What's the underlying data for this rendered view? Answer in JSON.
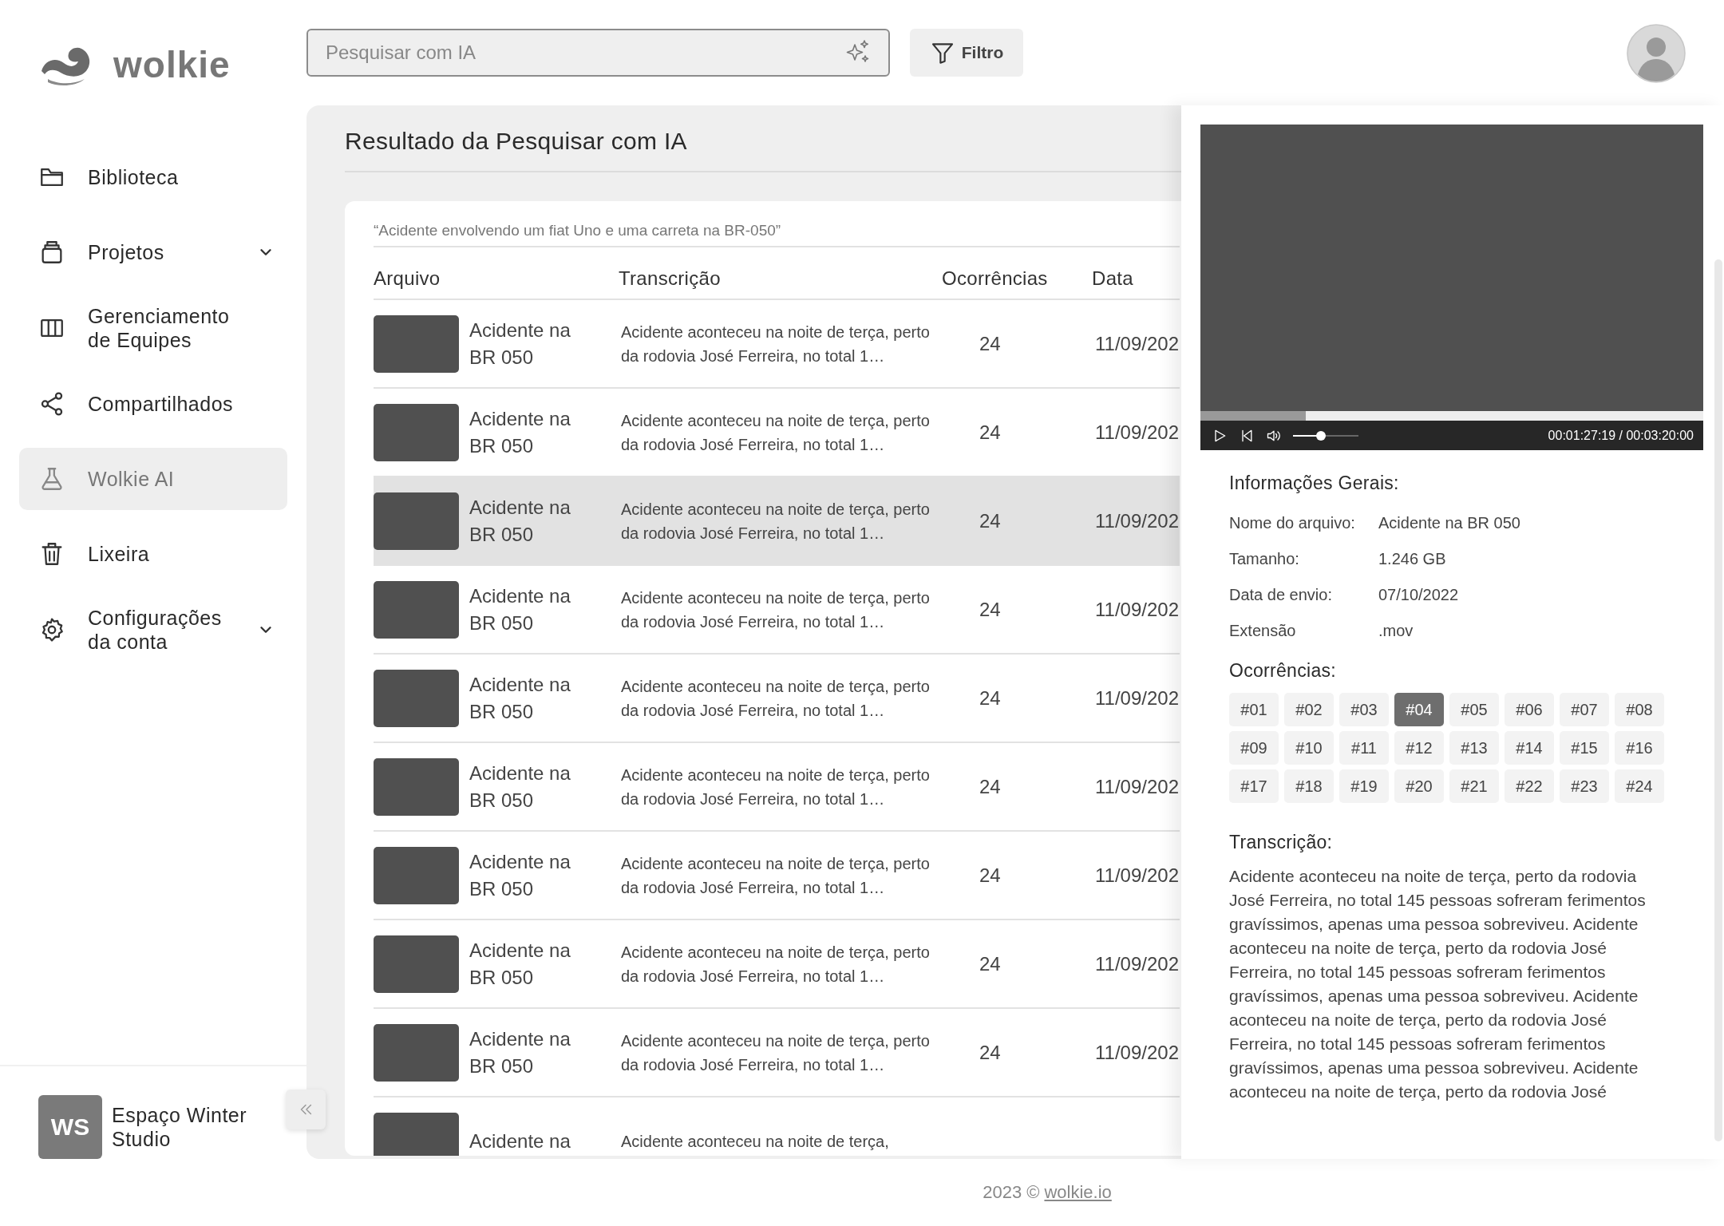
{
  "brand": {
    "name": "wolkie"
  },
  "search": {
    "placeholder": "Pesquisar com IA"
  },
  "filter_button": {
    "label": "Filtro"
  },
  "sidebar": {
    "items": [
      {
        "label": "Biblioteca",
        "selected": false,
        "has_submenu": false
      },
      {
        "label": "Projetos",
        "selected": false,
        "has_submenu": true
      },
      {
        "label": "Gerenciamento de Equipes",
        "selected": false,
        "has_submenu": false
      },
      {
        "label": "Compartilhados",
        "selected": false,
        "has_submenu": false
      },
      {
        "label": "Wolkie AI",
        "selected": true,
        "has_submenu": false
      },
      {
        "label": "Lixeira",
        "selected": false,
        "has_submenu": false
      },
      {
        "label": "Configurações da conta",
        "selected": false,
        "has_submenu": true
      }
    ]
  },
  "workspace": {
    "initials": "WS",
    "name": "Espaço Winter Studio"
  },
  "results": {
    "title": "Resultado da Pesquisar com IA",
    "query": "“Acidente envolvendo um fiat Uno e uma carreta na BR-050”",
    "columns": [
      "Arquivo",
      "Transcrição",
      "Ocorrências",
      "Data"
    ],
    "rows": [
      {
        "name": "Acidente na BR 050",
        "transcription": "Acidente aconteceu na noite de terça, perto da rodovia José Ferreira, no total 1…",
        "occurrences": "24",
        "date": "11/09/202",
        "selected": false
      },
      {
        "name": "Acidente na BR 050",
        "transcription": "Acidente aconteceu na noite de terça, perto da rodovia José Ferreira, no total 1…",
        "occurrences": "24",
        "date": "11/09/202",
        "selected": false
      },
      {
        "name": "Acidente na BR 050",
        "transcription": "Acidente aconteceu na noite de terça, perto da rodovia José Ferreira, no total 1…",
        "occurrences": "24",
        "date": "11/09/202",
        "selected": true
      },
      {
        "name": "Acidente na BR 050",
        "transcription": "Acidente aconteceu na noite de terça, perto da rodovia José Ferreira, no total 1…",
        "occurrences": "24",
        "date": "11/09/202",
        "selected": false
      },
      {
        "name": "Acidente na BR 050",
        "transcription": "Acidente aconteceu na noite de terça, perto da rodovia José Ferreira, no total 1…",
        "occurrences": "24",
        "date": "11/09/202",
        "selected": false
      },
      {
        "name": "Acidente na BR 050",
        "transcription": "Acidente aconteceu na noite de terça, perto da rodovia José Ferreira, no total 1…",
        "occurrences": "24",
        "date": "11/09/202",
        "selected": false
      },
      {
        "name": "Acidente na BR 050",
        "transcription": "Acidente aconteceu na noite de terça, perto da rodovia José Ferreira, no total 1…",
        "occurrences": "24",
        "date": "11/09/202",
        "selected": false
      },
      {
        "name": "Acidente na BR 050",
        "transcription": "Acidente aconteceu na noite de terça, perto da rodovia José Ferreira, no total 1…",
        "occurrences": "24",
        "date": "11/09/202",
        "selected": false
      },
      {
        "name": "Acidente na BR 050",
        "transcription": "Acidente aconteceu na noite de terça, perto da rodovia José Ferreira, no total 1…",
        "occurrences": "24",
        "date": "11/09/202",
        "selected": false
      },
      {
        "name": "Acidente na",
        "transcription": "Acidente aconteceu na noite de terça,",
        "selected": false
      }
    ]
  },
  "details": {
    "player": {
      "progress": {
        "level": 0.21
      },
      "volume": {
        "level": 0.43
      },
      "time": "00:01:27:19 / 00:03:20:00"
    },
    "info_title": "Informações Gerais:",
    "fields": [
      {
        "label": "Nome do arquivo:",
        "value": "Acidente na BR 050"
      },
      {
        "label": "Tamanho:",
        "value": "1.246 GB"
      },
      {
        "label": "Data de envio:",
        "value": "07/10/2022"
      },
      {
        "label": "Extensão",
        "value": ".mov"
      }
    ],
    "occurrences_title": "Ocorrências:",
    "occurrences": [
      {
        "label": "#01",
        "selected": false
      },
      {
        "label": "#02",
        "selected": false
      },
      {
        "label": "#03",
        "selected": false
      },
      {
        "label": "#04",
        "selected": true
      },
      {
        "label": "#05",
        "selected": false
      },
      {
        "label": "#06",
        "selected": false
      },
      {
        "label": "#07",
        "selected": false
      },
      {
        "label": "#08",
        "selected": false
      },
      {
        "label": "#09",
        "selected": false
      },
      {
        "label": "#10",
        "selected": false
      },
      {
        "label": "#11",
        "selected": false
      },
      {
        "label": "#12",
        "selected": false
      },
      {
        "label": "#13",
        "selected": false
      },
      {
        "label": "#14",
        "selected": false
      },
      {
        "label": "#15",
        "selected": false
      },
      {
        "label": "#16",
        "selected": false
      },
      {
        "label": "#17",
        "selected": false
      },
      {
        "label": "#18",
        "selected": false
      },
      {
        "label": "#19",
        "selected": false
      },
      {
        "label": "#20",
        "selected": false
      },
      {
        "label": "#21",
        "selected": false
      },
      {
        "label": "#22",
        "selected": false
      },
      {
        "label": "#23",
        "selected": false
      },
      {
        "label": "#24",
        "selected": false
      }
    ],
    "transcription_title": "Transcrição:",
    "transcription": "Acidente aconteceu na noite de terça, perto da rodovia José Ferreira, no total 145 pessoas sofreram ferimentos gravíssimos, apenas uma pessoa sobreviveu. Acidente aconteceu na noite de terça, perto da rodovia José Ferreira, no total 145 pessoas sofreram ferimentos gravíssimos, apenas uma pessoa sobreviveu. Acidente aconteceu na noite de terça, perto da rodovia José Ferreira, no total 145 pessoas sofreram ferimentos gravíssimos, apenas uma pessoa sobreviveu. Acidente aconteceu na noite de terça, perto da rodovia José"
  },
  "footer": {
    "text": "2023 ©",
    "link": "wolkie.io"
  }
}
